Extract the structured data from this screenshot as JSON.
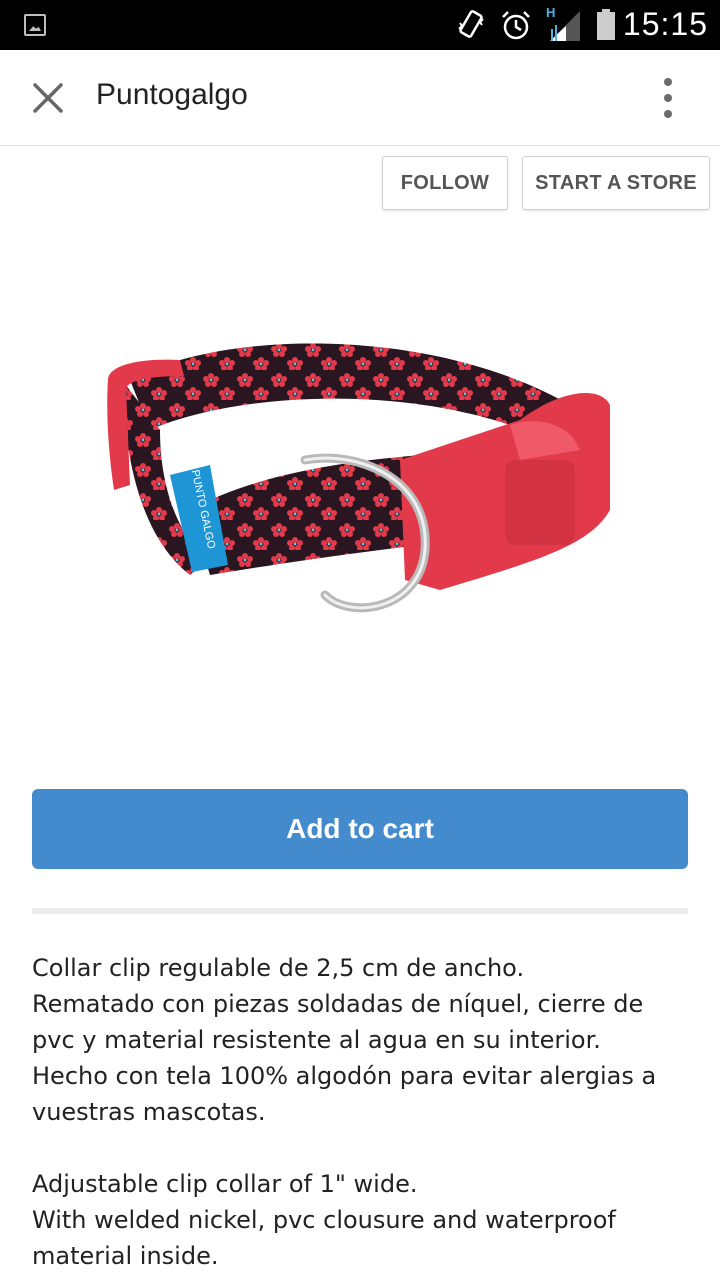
{
  "status_bar": {
    "time": "15:15",
    "network_label": "H",
    "icons": [
      "image-notification-icon",
      "vibrate-icon",
      "alarm-icon",
      "signal-icon",
      "battery-icon"
    ]
  },
  "app_bar": {
    "title": "Puntogalgo",
    "close_icon": "close-icon",
    "menu_icon": "more-vert-icon"
  },
  "actions": {
    "follow_label": "FOLLOW",
    "start_store_label": "START A STORE"
  },
  "product": {
    "image": "red-floral-dog-collar",
    "tag_text": "PUNTO GALGO"
  },
  "cart": {
    "label": "Add to cart"
  },
  "description": {
    "spanish": "Collar clip regulable de 2,5 cm de ancho.\nRematado con piezas soldadas de níquel, cierre de pvc y material resistente al agua en su interior.\nHecho con tela 100% algodón para evitar alergias a vuestras mascotas.",
    "english": "Adjustable clip collar of 1\" wide.\nWith welded nickel, pvc clousure and waterproof material inside."
  },
  "colors": {
    "accent": "#448bcd",
    "status_bar": "#000000",
    "collar_fabric": "#2a1620",
    "collar_clip": "#e23a4a",
    "tag": "#1e95d4"
  }
}
